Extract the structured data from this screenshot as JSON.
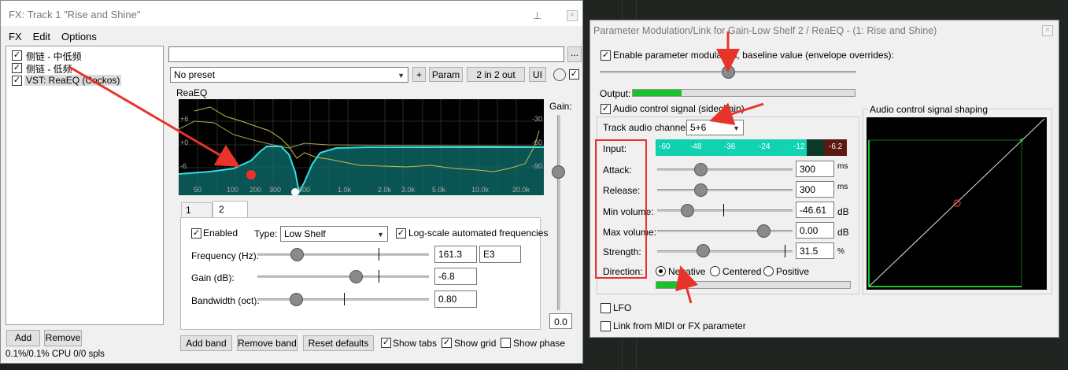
{
  "fx_window": {
    "title": "FX: Track 1 \"Rise and Shine\"",
    "menu": [
      "FX",
      "Edit",
      "Options"
    ],
    "fx_list": [
      {
        "label": "侧链 - 中低频",
        "checked": true
      },
      {
        "label": "侧链 - 低频",
        "checked": true
      },
      {
        "label": "VST: ReaEQ (Cockos)",
        "checked": true,
        "selected": true
      }
    ],
    "add_label": "Add",
    "remove_label": "Remove",
    "status": "0.1%/0.1% CPU 0/0 spls",
    "browse_label": "...",
    "preset": "No preset",
    "plus_label": "+",
    "param_label": "Param",
    "io_label": "2 in 2 out",
    "ui_label": "UI",
    "plugin_name": "ReaEQ",
    "gain_label": "Gain:",
    "gain_value": "0.0",
    "graph": {
      "db_labels_left": [
        "+6",
        "+0",
        "-6"
      ],
      "db_labels_right": [
        "-30",
        "-60",
        "-90"
      ],
      "freq_labels": [
        "50",
        "100",
        "200",
        "300",
        "500",
        "1.0k",
        "2.0k",
        "3.0k",
        "5.0k",
        "10.0k",
        "20.0k"
      ]
    },
    "tabs": [
      "1",
      "2"
    ],
    "band": {
      "enabled_label": "Enabled",
      "type_label": "Type:",
      "type_value": "Low Shelf",
      "logscale_label": "Log-scale automated frequencies",
      "freq_label": "Frequency (Hz):",
      "freq_value": "161.3",
      "note_value": "E3",
      "gain_label": "Gain (dB):",
      "gain_value": "-6.8",
      "bw_label": "Bandwidth (oct):",
      "bw_value": "0.80"
    },
    "bottom": {
      "add_band": "Add band",
      "remove_band": "Remove band",
      "reset": "Reset defaults",
      "show_tabs": "Show tabs",
      "show_grid": "Show grid",
      "show_phase": "Show phase"
    }
  },
  "pm_window": {
    "title": "Parameter Modulation/Link for Gain-Low Shelf 2 / ReaEQ - (1: Rise and Shine)",
    "enable_label": "Enable parameter modulation, baseline value (envelope overrides):",
    "output_label": "Output:",
    "output_level": 0.22,
    "acs_label": "Audio control signal (sidechain)",
    "channel_label": "Track audio channel:",
    "channel_value": "5+6",
    "meter_labels": [
      "-60",
      "-48",
      "-36",
      "-24",
      "-12",
      "-6.2"
    ],
    "input_label": "Input:",
    "params": [
      {
        "label": "Attack:",
        "value": "300",
        "unit": "ms"
      },
      {
        "label": "Release:",
        "value": "300",
        "unit": "ms"
      },
      {
        "label": "Min volume:",
        "value": "-46.61",
        "unit": "dB"
      },
      {
        "label": "Max volume:",
        "value": "0.00",
        "unit": "dB"
      },
      {
        "label": "Strength:",
        "value": "31.5",
        "unit": "%"
      }
    ],
    "direction_label": "Direction:",
    "directions": [
      "Negative",
      "Centered",
      "Positive"
    ],
    "lfo_label": "LFO",
    "link_label": "Link from MIDI or FX parameter",
    "shaping_label": "Audio control signal shaping"
  },
  "colors": {
    "annotation": "#e8332a",
    "eq_curve": "#2ee0e8",
    "meter_green": "#19c12a",
    "cyan_meter": "#10d0b0"
  }
}
